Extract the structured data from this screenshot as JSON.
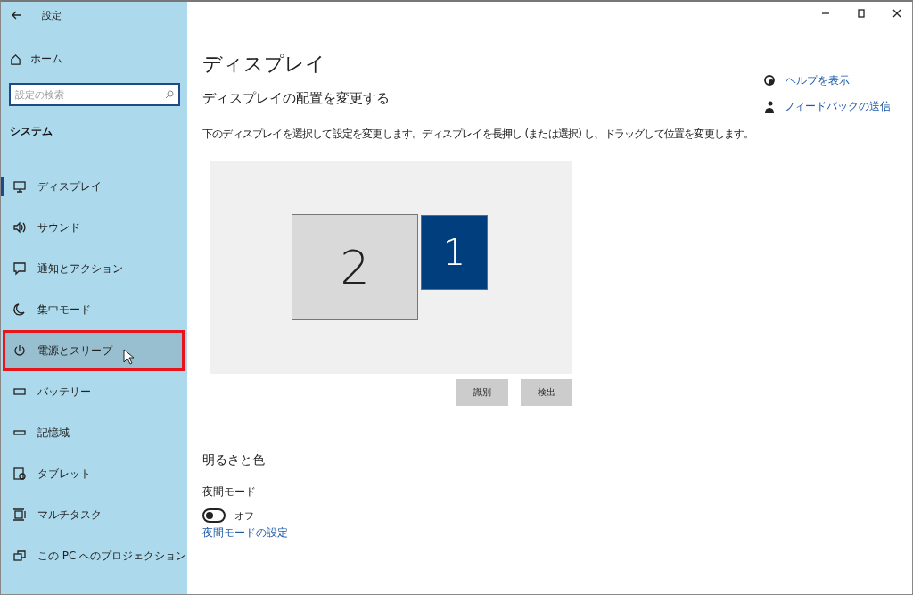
{
  "window": {
    "title": "設定"
  },
  "sidebar": {
    "home": "ホーム",
    "search": {
      "placeholder": "設定の検索"
    },
    "section": "システム",
    "items": [
      {
        "label": "ディスプレイ",
        "selected": true,
        "highlighted": false
      },
      {
        "label": "サウンド",
        "selected": false,
        "highlighted": false
      },
      {
        "label": "通知とアクション",
        "selected": false,
        "highlighted": false
      },
      {
        "label": "集中モード",
        "selected": false,
        "highlighted": false
      },
      {
        "label": "電源とスリープ",
        "selected": false,
        "highlighted": true
      },
      {
        "label": "バッテリー",
        "selected": false,
        "highlighted": false
      },
      {
        "label": "記憶域",
        "selected": false,
        "highlighted": false
      },
      {
        "label": "タブレット",
        "selected": false,
        "highlighted": false
      },
      {
        "label": "マルチタスク",
        "selected": false,
        "highlighted": false
      },
      {
        "label": "この PC へのプロジェクション",
        "selected": false,
        "highlighted": false
      }
    ]
  },
  "page": {
    "title": "ディスプレイ",
    "heading": "ディスプレイの配置を変更する",
    "description": "下のディスプレイを選択して設定を変更します。ディスプレイを長押し (または選択) し、ドラッグして位置を変更します。",
    "monitors": [
      {
        "label": "2",
        "selected": false
      },
      {
        "label": "1",
        "selected": true
      }
    ],
    "buttons": [
      "識別",
      "検出"
    ],
    "section": "明るさと色",
    "night_mode": {
      "label": "夜間モード",
      "on": false,
      "state": "オフ"
    },
    "link": "夜間モードの設定"
  },
  "help_links": [
    {
      "label": "ヘルプを表示"
    },
    {
      "label": "フィードバックの送信"
    }
  ]
}
